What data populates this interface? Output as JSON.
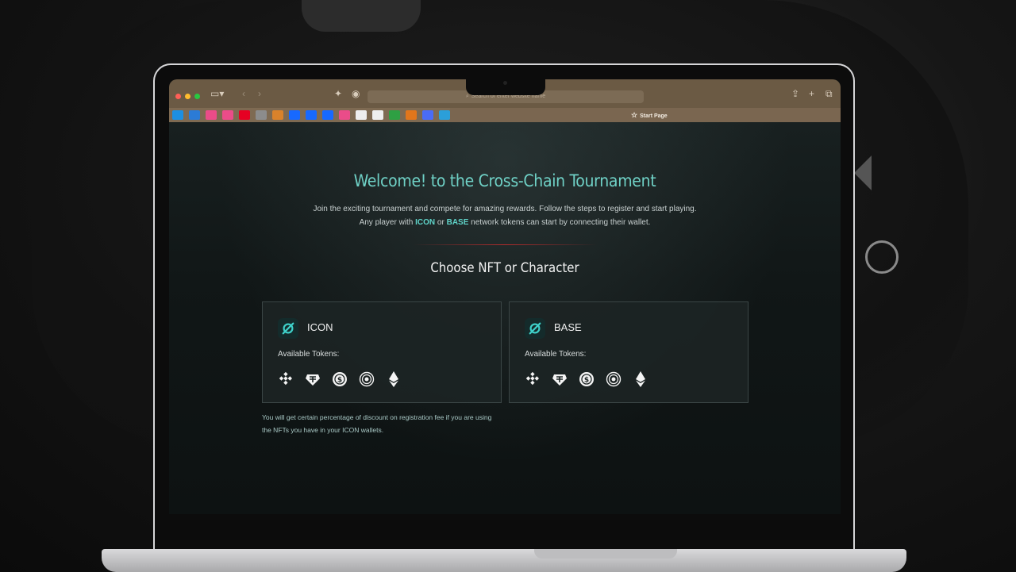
{
  "browser": {
    "url_placeholder": "Search or enter website name",
    "start_tab_label": "Start Page",
    "bookmarks": [
      {
        "icon": "cloud-icon",
        "color": "#1d8fe1"
      },
      {
        "icon": "vscode-icon",
        "color": "#2b7bd6"
      },
      {
        "icon": "dribbble-icon",
        "color": "#ea4c89"
      },
      {
        "icon": "dribbble-icon",
        "color": "#ea4c89"
      },
      {
        "icon": "pinterest-icon",
        "color": "#e60023"
      },
      {
        "icon": "p-icon",
        "color": "#8c8c8c"
      },
      {
        "icon": "burger-icon",
        "color": "#d9822b"
      },
      {
        "icon": "behance-icon",
        "color": "#1769ff"
      },
      {
        "icon": "behance-icon",
        "color": "#1769ff"
      },
      {
        "icon": "behance-icon",
        "color": "#1769ff"
      },
      {
        "icon": "dribbble-icon",
        "color": "#ea4c89"
      },
      {
        "icon": "clapper-icon",
        "color": "#eeeeee"
      },
      {
        "icon": "nyt-icon",
        "color": "#eeeeee"
      },
      {
        "icon": "palm-icon",
        "color": "#2ea043"
      },
      {
        "icon": "fox-icon",
        "color": "#e2761b"
      },
      {
        "icon": "triangle-icon",
        "color": "#4a6cf7"
      },
      {
        "icon": "drop-icon",
        "color": "#2b9fd9"
      }
    ]
  },
  "page": {
    "title": "Welcome! to the Cross-Chain Tournament",
    "intro_part1": "Join the exciting tournament and compete for amazing rewards. Follow the steps to register and start playing. Any player with ",
    "intro_hl1": "ICON",
    "intro_part2": " or ",
    "intro_hl2": "BASE",
    "intro_part3": " network tokens can start by connecting their wallet.",
    "choose_heading": "Choose NFT or Character",
    "cards": [
      {
        "name": "ICON",
        "available_label": "Available Tokens:"
      },
      {
        "name": "BASE",
        "available_label": "Available Tokens:"
      }
    ],
    "tokens": [
      "bnb-icon",
      "usdt-icon",
      "usdc-icon",
      "sushi-icon",
      "eth-icon"
    ],
    "discount_note": "You will get certain percentage of discount on registration fee if you are using the NFTs you have in your ICON wallets."
  },
  "colors": {
    "accent": "#6fd1c6",
    "highlight": "#5fd3c8",
    "divider": "#b12c2c"
  }
}
